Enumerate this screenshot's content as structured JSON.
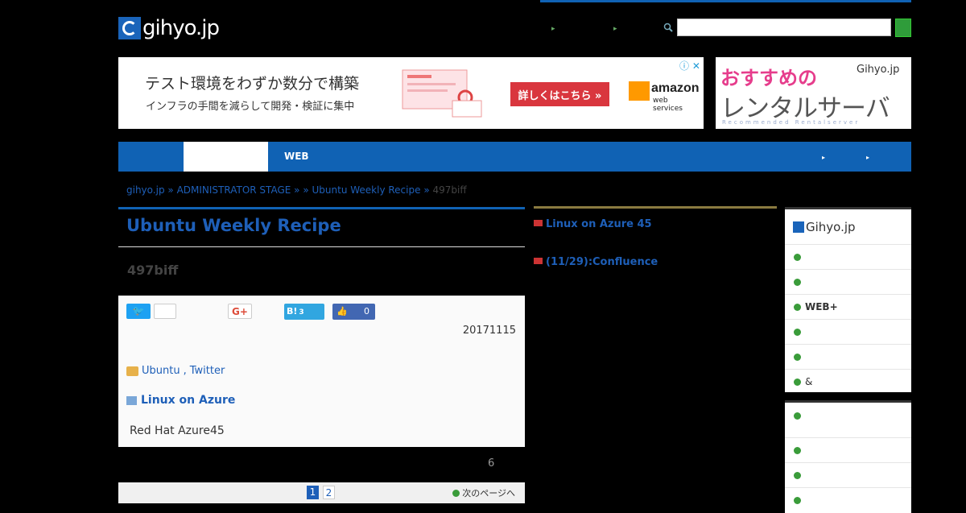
{
  "header": {
    "logo_text": "gihyo.jp",
    "links": [
      "",
      ""
    ],
    "search_placeholder": ""
  },
  "ads": {
    "ad1_headline": "テスト環境をわずか数分で構築",
    "ad1_sub": "インフラの手間を減らして開発・検証に集中",
    "ad1_button": "詳しくはこちら »",
    "ad1_brand": "amazon",
    "ad1_brand_sub": "web services",
    "ad2_line1": "おすすめの",
    "ad2_line2": "レンタルサーバ",
    "ad2_line3": "Recommended Rentalserver",
    "ad2_logo": "Gihyo.jp"
  },
  "nav": {
    "items": [
      "",
      "",
      "WEB",
      ""
    ],
    "right": [
      "",
      ""
    ]
  },
  "breadcrumb": {
    "items": [
      "gihyo.jp",
      "ADMINISTRATOR STAGE",
      "",
      "Ubuntu Weekly Recipe"
    ],
    "separator": "»",
    "current": "497biff"
  },
  "article": {
    "series_title": "Ubuntu Weekly Recipe",
    "subtitle": "497biff",
    "tweet_label": "",
    "tweet_count": "",
    "gplus_label": "G+",
    "hatena_label": "B!",
    "hatena_count": "3",
    "like_count": "0",
    "date": "20171115",
    "tags": [
      "Ubuntu",
      "Twitter"
    ],
    "tags_sep": ",",
    "related_title": "Linux on Azure",
    "related_text": "Red Hat Azure45",
    "page_number": "6",
    "pager": [
      "1",
      "2"
    ],
    "next_label": "次のページへ"
  },
  "news": [
    {
      "text": "Linux on Azure  45"
    },
    {
      "text": "(11/29):Confluence"
    }
  ],
  "sidebar": {
    "logo": "Gihyo.jp",
    "items": [
      "",
      "",
      "WEB+",
      "",
      "",
      "&"
    ],
    "section2_title": "",
    "section2_items": [
      "",
      "",
      ""
    ]
  }
}
